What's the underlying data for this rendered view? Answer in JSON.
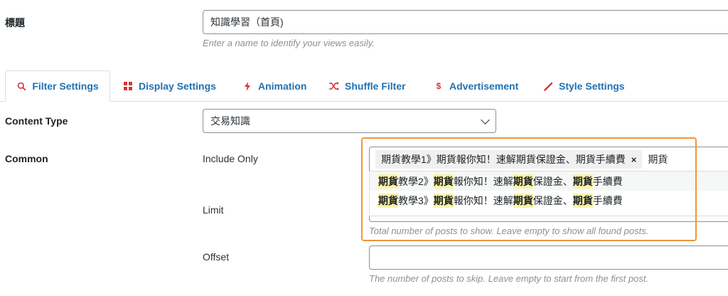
{
  "title_row": {
    "label": "標題",
    "value": "知識學習（首頁)",
    "help": "Enter a name to identify your views easily."
  },
  "tabs": [
    {
      "label": "Filter Settings",
      "icon": "search-icon",
      "active": true
    },
    {
      "label": "Display Settings",
      "icon": "grid-icon",
      "active": false
    },
    {
      "label": "Animation",
      "icon": "bolt-icon",
      "active": false
    },
    {
      "label": "Shuffle Filter",
      "icon": "shuffle-icon",
      "active": false
    },
    {
      "label": "Advertisement",
      "icon": "dollar-icon",
      "active": false
    },
    {
      "label": "Style Settings",
      "icon": "pen-icon",
      "active": false
    }
  ],
  "content_type": {
    "label": "Content Type",
    "selected": "交易知識"
  },
  "common": {
    "label": "Common",
    "include_only": {
      "label": "Include Only",
      "chip": "期貨教學1》期貨報你知！速解期貨保證金、期貨手續費",
      "chip_remove": "×",
      "typed": "期貨",
      "suggestions": [
        [
          "期貨",
          "教學2》",
          "期貨",
          "報你知！速解",
          "期貨",
          "保證金、",
          "期貨",
          "手續費"
        ],
        [
          "期貨",
          "教學3》",
          "期貨",
          "報你知！速解",
          "期貨",
          "保證金、",
          "期貨",
          "手續費"
        ]
      ]
    },
    "limit": {
      "label": "Limit",
      "help": "Total number of posts to show. Leave empty to show all found posts."
    },
    "offset": {
      "label": "Offset",
      "value": "",
      "help": "The number of posts to skip. Leave empty to start from the first post."
    }
  },
  "colors": {
    "accent": "#2271b1",
    "highlight": "#fbf2a6",
    "focus_outline": "#f0963a",
    "tab_icon_colors": [
      "#d63638",
      "#d63638",
      "#d63638",
      "#d63638",
      "#d63638",
      "#d63638"
    ]
  }
}
